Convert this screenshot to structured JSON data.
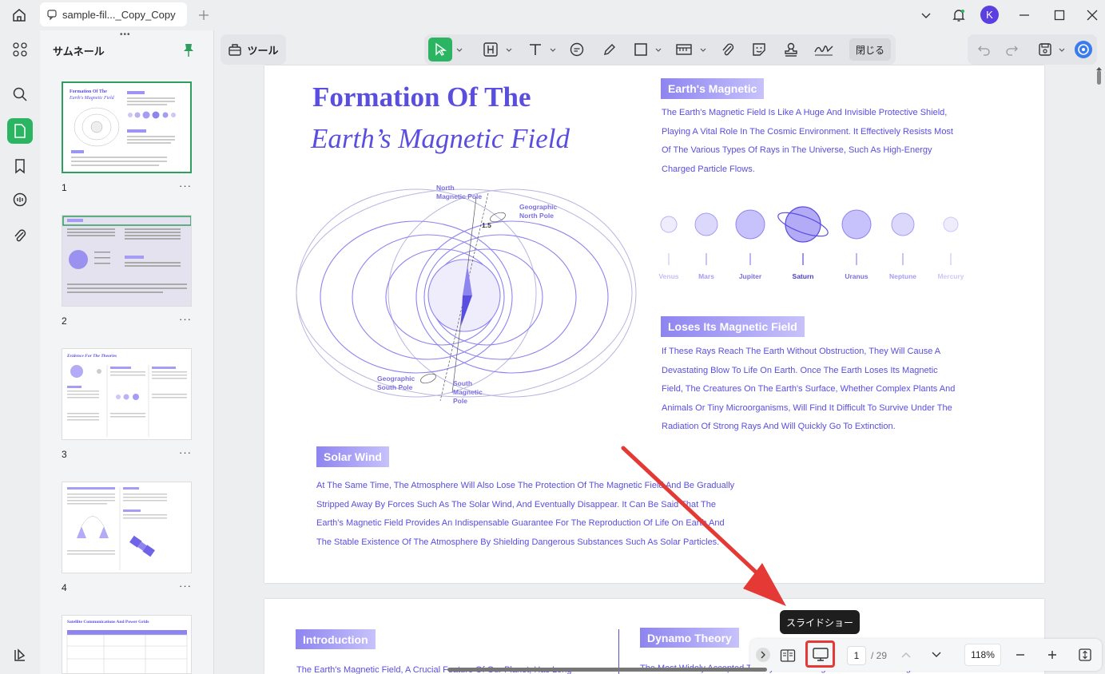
{
  "window": {
    "tab_title": "sample-fil..._Copy_Copy",
    "avatar_letter": "K"
  },
  "sidebar": {
    "panel_title": "サムネール",
    "thumbnails": [
      {
        "number": "1",
        "more": "···"
      },
      {
        "number": "2",
        "more": "···"
      },
      {
        "number": "3",
        "more": "···"
      },
      {
        "number": "4",
        "more": "···"
      }
    ],
    "thumb_texts": {
      "t1_title1": "Formation Of The",
      "t1_title2": "Earth's Magnetic Field",
      "t3_title": "Evidence For The Theories",
      "t5_title": "Satellite Communications And Power Grids"
    }
  },
  "toolbar": {
    "tools_label": "ツール",
    "close_label": "閉じる"
  },
  "page1": {
    "title_line1": "Formation Of The",
    "title_line2": "Earth’s Magnetic Field",
    "diagram_labels": {
      "north_magnetic": "North\nMagnetic Pole",
      "geo_north": "Geographic\nNorth Pole",
      "angle": "1.5",
      "geo_south": "Geographic\nSouth Pole",
      "south_magnetic": "South\nMagnetic\nPole"
    },
    "sections": {
      "earths_magnetic": {
        "heading": "Earth's Magnetic",
        "lines": [
          "The Earth's Magnetic Field Is Like A Huge And Invisible Protective Shield,",
          "Playing A Vital Role In The Cosmic Environment. It Effectively Resists Most",
          "Of The Various Types Of Rays in The Universe, Such As High-Energy",
          "Charged Particle Flows."
        ]
      },
      "loses": {
        "heading": "Loses Its Magnetic Field",
        "lines": [
          "If These Rays Reach The Earth Without Obstruction, They Will Cause A",
          "Devastating Blow To Life On Earth. Once The Earth Loses Its Magnetic",
          "Field, The Creatures On The Earth's Surface, Whether Complex Plants And",
          "Animals Or Tiny Microorganisms, Will Find It Difficult To Survive Under The",
          "Radiation Of Strong Rays And Will Quickly Go To Extinction."
        ]
      },
      "solar_wind": {
        "heading": "Solar Wind",
        "lines": [
          "At The Same Time, The Atmosphere Will Also Lose The Protection Of The Magnetic Field And Be Gradually",
          "Stripped Away By Forces Such As The Solar Wind, And Eventually Disappear. It Can Be Said That The",
          "Earth's Magnetic Field Provides An Indispensable Guarantee For The Reproduction Of Life On Earth And",
          "The Stable Existence Of The Atmosphere By Shielding Dangerous Substances Such As Solar Particles."
        ]
      }
    },
    "planets": [
      "Venus",
      "Mars",
      "Jupiter",
      "Saturn",
      "Uranus",
      "Neptune",
      "Mercury"
    ]
  },
  "page2": {
    "intro_heading": "Introduction",
    "dynamo_heading": "Dynamo Theory",
    "intro_line": "The Earth's Magnetic Field, A Crucial Feature Of Our Planet, Has Long",
    "dynamo_line": "The Most Widely Accepted Theory For The Origin Of The Earth's Magnetic Field Is"
  },
  "bottombar": {
    "tooltip": "スライドショー",
    "page_current": "1",
    "page_total": "/ 29",
    "zoom": "118%"
  },
  "colors": {
    "accent_green": "#2bb562",
    "doc_purple": "#5a4ee0",
    "highlight_red": "#e53935"
  }
}
